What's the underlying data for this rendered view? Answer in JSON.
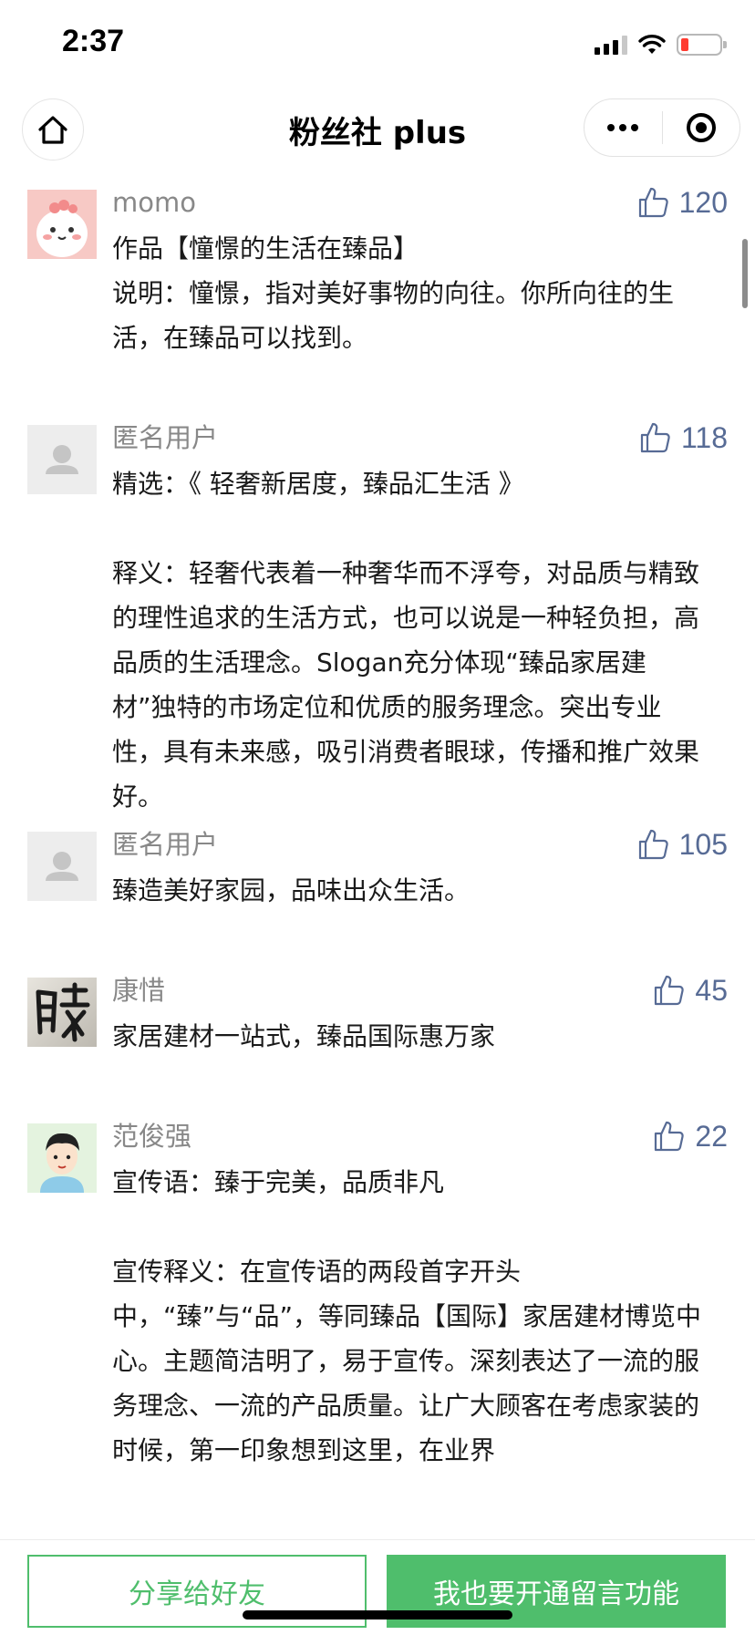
{
  "status_bar": {
    "time": "2:37"
  },
  "nav": {
    "title": "粉丝社 plus"
  },
  "comments": [
    {
      "author": "momo",
      "likes": "120",
      "avatar": "pink-cartoon",
      "paragraphs": [
        "作品【憧憬的生活在臻品】",
        "说明：憧憬，指对美好事物的向往。你所向往的生活，在臻品可以找到。"
      ]
    },
    {
      "author": "匿名用户",
      "likes": "118",
      "avatar": "default",
      "paragraphs": [
        "精选：《 轻奢新居度，臻品汇生活 》",
        "",
        "释义：轻奢代表着一种奢华而不浮夸，对品质与精致的理性追求的生活方式，也可以说是一种轻负担，高品质的生活理念。Slogan充分体现“臻品家居建材”独特的市场定位和优质的服务理念。突出专业性，具有未来感，吸引消费者眼球，传播和推广效果好。"
      ]
    },
    {
      "author": "匿名用户",
      "likes": "105",
      "avatar": "default",
      "paragraphs": [
        "臻造美好家园，品味出众生活。"
      ]
    },
    {
      "author": "康惜",
      "likes": "45",
      "avatar": "calligraphy",
      "paragraphs": [
        "家居建材一站式，臻品国际惠万家"
      ]
    },
    {
      "author": "范俊强",
      "likes": "22",
      "avatar": "cartoon-boy",
      "paragraphs": [
        "宣传语：臻于完美，品质非凡",
        "",
        "宣传释义：在宣传语的两段首字开头中，“臻”与“品”，等同臻品【国际】家居建材博览中心。主题简洁明了，易于宣传。深刻表达了一流的服务理念、一流的产品质量。让广大顾客在考虑家装的时候，第一印象想到这里，在业界"
      ]
    }
  ],
  "bottom": {
    "share_label": "分享给好友",
    "open_label": "我也要开通留言功能"
  },
  "colors": {
    "accent_green": "#4fbe6c",
    "like_blue": "#576b95",
    "author_gray": "#888888"
  }
}
